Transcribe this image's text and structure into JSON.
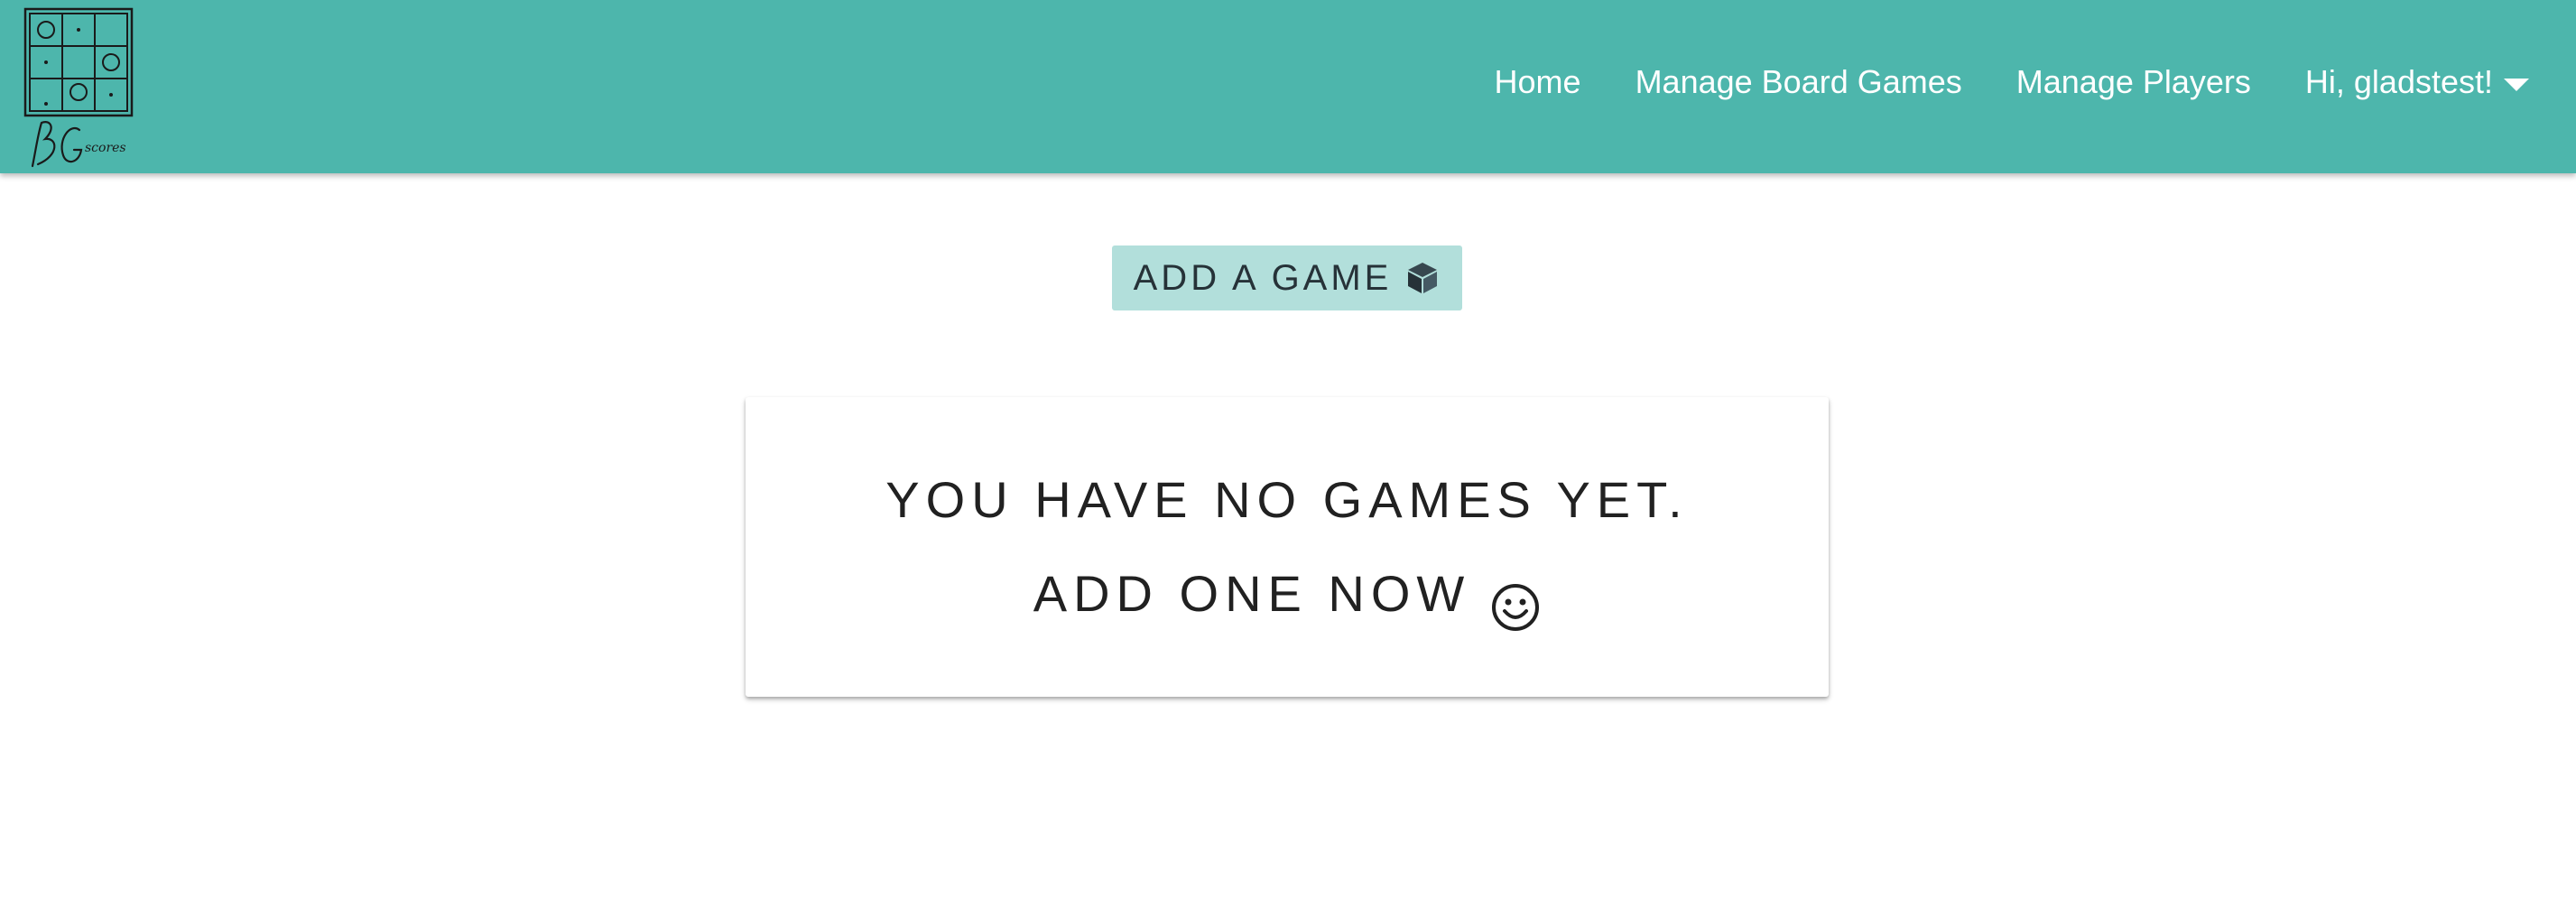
{
  "header": {
    "logo_text": "BG scores",
    "nav": {
      "home_label": "Home",
      "manage_board_games_label": "Manage Board Games",
      "manage_players_label": "Manage Players",
      "user_greeting": "Hi, gladstest!"
    }
  },
  "main": {
    "add_game_label": "ADD A GAME",
    "add_game_icon": "cube-icon",
    "empty_state": {
      "line1": "YOU HAVE NO GAMES YET.",
      "line2": "ADD ONE NOW",
      "line2_icon": "smile-icon"
    }
  },
  "colors": {
    "navbar_bg": "#4db6ac",
    "button_bg": "#b2dfdb",
    "nav_text": "#ffffff",
    "body_text": "#212121"
  }
}
